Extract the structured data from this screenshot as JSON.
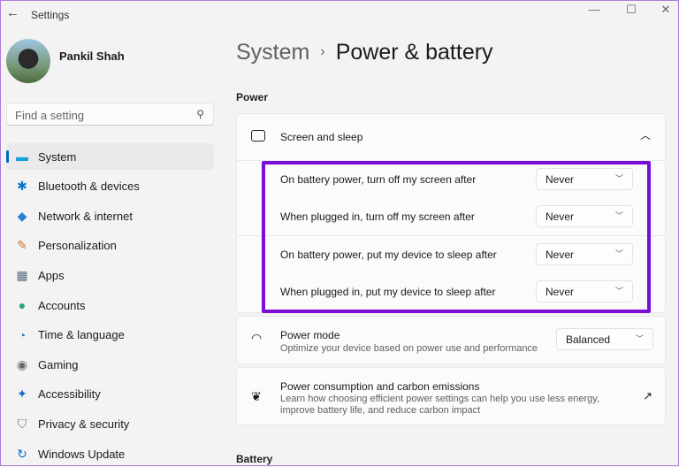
{
  "window": {
    "title": "Settings",
    "back_icon": "arrow-left-icon",
    "controls": [
      "—",
      "☐",
      "✕"
    ]
  },
  "user": {
    "name": "Pankil Shah"
  },
  "search": {
    "placeholder": "Find a setting"
  },
  "sidebar": {
    "items": [
      {
        "label": "System",
        "icon": "▬",
        "color": "#1a9fd9"
      },
      {
        "label": "Bluetooth & devices",
        "icon": "✱",
        "color": "#0a74d1"
      },
      {
        "label": "Network & internet",
        "icon": "◆",
        "color": "#2b7fd6"
      },
      {
        "label": "Personalization",
        "icon": "✎",
        "color": "#c8752d"
      },
      {
        "label": "Apps",
        "icon": "▦",
        "color": "#5a6a80"
      },
      {
        "label": "Accounts",
        "icon": "●",
        "color": "#23a37a"
      },
      {
        "label": "Time & language",
        "icon": "◔",
        "color": "#2089c9"
      },
      {
        "label": "Gaming",
        "icon": "◉",
        "color": "#6a6a6a"
      },
      {
        "label": "Accessibility",
        "icon": "✦",
        "color": "#1468c8"
      },
      {
        "label": "Privacy & security",
        "icon": "⛉",
        "color": "#6a7582"
      },
      {
        "label": "Windows Update",
        "icon": "↻",
        "color": "#0a6cd0"
      }
    ]
  },
  "header": {
    "parent": "System",
    "separator": "›",
    "title": "Power & battery"
  },
  "power": {
    "section": "Power",
    "screen_sleep": {
      "label": "Screen and sleep",
      "rows": [
        {
          "label": "On battery power, turn off my screen after",
          "value": "Never"
        },
        {
          "label": "When plugged in, turn off my screen after",
          "value": "Never"
        },
        {
          "label": "On battery power, put my device to sleep after",
          "value": "Never"
        },
        {
          "label": "When plugged in, put my device to sleep after",
          "value": "Never"
        }
      ]
    },
    "power_mode": {
      "label": "Power mode",
      "description": "Optimize your device based on power use and performance",
      "value": "Balanced"
    },
    "carbon": {
      "label": "Power consumption and carbon emissions",
      "description": "Learn how choosing efficient power settings can help you use less energy, improve battery life, and reduce carbon impact"
    }
  },
  "battery": {
    "section": "Battery"
  },
  "highlight_color": "#7a0dd6"
}
